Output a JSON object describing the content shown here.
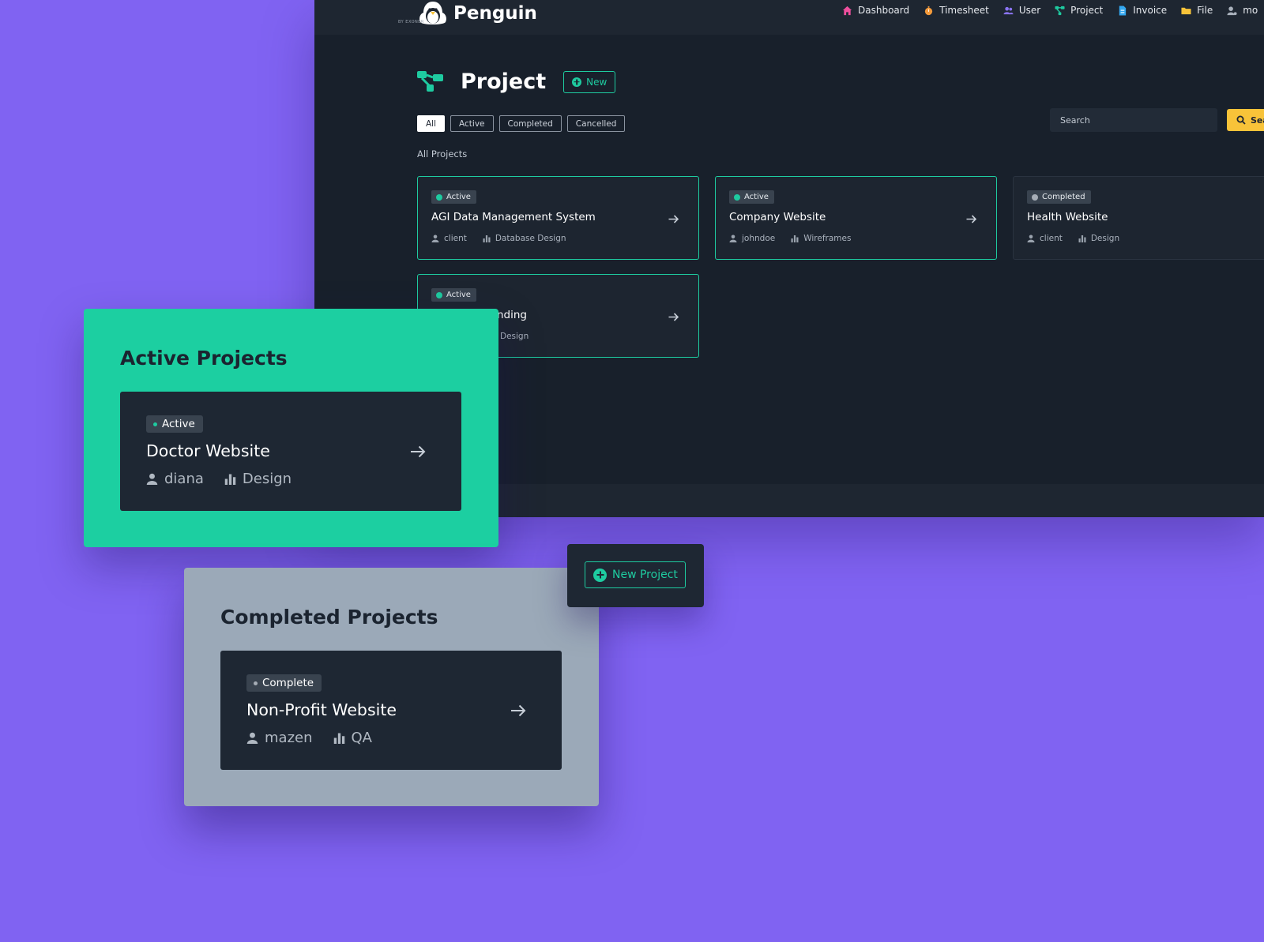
{
  "brand": {
    "name": "Penguin",
    "sub": "BY EXONER"
  },
  "nav": [
    {
      "label": "Dashboard",
      "icon": "home-icon",
      "color": "#ef4f9d"
    },
    {
      "label": "Timesheet",
      "icon": "stopwatch-icon",
      "color": "#f39a3b"
    },
    {
      "label": "User",
      "icon": "users-icon",
      "color": "#8a74f4"
    },
    {
      "label": "Project",
      "icon": "project-icon",
      "color": "#1ecba0"
    },
    {
      "label": "Invoice",
      "icon": "invoice-icon",
      "color": "#33a7ef"
    },
    {
      "label": "File",
      "icon": "folder-icon",
      "color": "#f8c339"
    },
    {
      "label": "mo",
      "icon": "user-settings-icon",
      "color": "#aab2bd"
    }
  ],
  "page": {
    "title": "Project",
    "new_label": "New"
  },
  "filters": [
    {
      "label": "All",
      "selected": true
    },
    {
      "label": "Active",
      "selected": false
    },
    {
      "label": "Completed",
      "selected": false
    },
    {
      "label": "Cancelled",
      "selected": false
    }
  ],
  "search": {
    "placeholder": "Search",
    "button": "Sea"
  },
  "section_label": "All Projects",
  "projects": [
    {
      "status": "Active",
      "title": "AGI Data Management System",
      "user": "client",
      "task": "Database Design"
    },
    {
      "status": "Active",
      "title": "Company Website",
      "user": "johndoe",
      "task": "Wireframes"
    },
    {
      "status": "Completed",
      "title": "Health Website",
      "user": "client",
      "task": "Design"
    },
    {
      "status": "Active",
      "title": "nding",
      "user": "",
      "task": "Design"
    }
  ],
  "active_panel": {
    "title": "Active Projects",
    "card": {
      "status": "Active",
      "title": "Doctor Website",
      "user": "diana",
      "task": "Design"
    }
  },
  "completed_panel": {
    "title": "Completed Projects",
    "card": {
      "status": "Complete",
      "title": "Non-Profit Website",
      "user": "mazen",
      "task": "QA"
    }
  },
  "new_project_label": "New Project",
  "colors": {
    "background": "#8063f2",
    "accent": "#1ecba0",
    "app": "#18202b",
    "search_button": "#f8c339"
  }
}
